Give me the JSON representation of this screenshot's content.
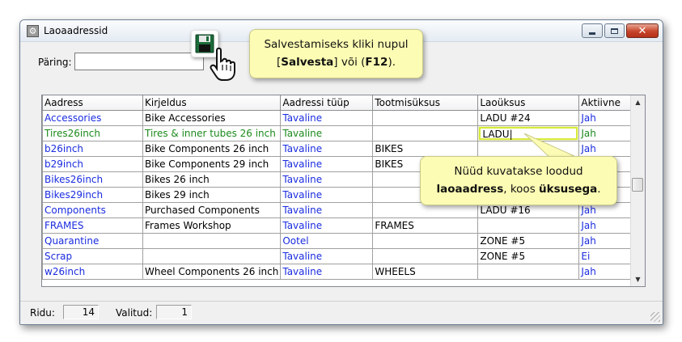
{
  "window": {
    "title": "Laoaadressid"
  },
  "query": {
    "label": "Päring:",
    "value": ""
  },
  "grid": {
    "columns": [
      "Aadress",
      "Kirjeldus",
      "Aadressi tüüp",
      "Tootmisüksus",
      "Laoüksus",
      "Aktiivne"
    ],
    "rows": [
      {
        "aadress": "Accessories",
        "kirjeldus": "Bike Accessories",
        "tyyp": "Tavaline",
        "tootmisyksus": "",
        "laoyksus": "LADU #24",
        "aktiivne": "Jah"
      },
      {
        "aadress": "Tires26inch",
        "kirjeldus": "Tires & inner tubes 26 inch",
        "tyyp": "Tavaline",
        "tootmisyksus": "",
        "laoyksus": "LADU",
        "aktiivne": "Jah"
      },
      {
        "aadress": "b26inch",
        "kirjeldus": "Bike Components 26 inch",
        "tyyp": "Tavaline",
        "tootmisyksus": "BIKES",
        "laoyksus": "",
        "aktiivne": "Jah"
      },
      {
        "aadress": "b29inch",
        "kirjeldus": "Bike Components 29 inch",
        "tyyp": "Tavaline",
        "tootmisyksus": "BIKES",
        "laoyksus": "",
        "aktiivne": ""
      },
      {
        "aadress": "Bikes26inch",
        "kirjeldus": "Bikes 26 inch",
        "tyyp": "Tavaline",
        "tootmisyksus": "",
        "laoyksus": "",
        "aktiivne": ""
      },
      {
        "aadress": "Bikes29inch",
        "kirjeldus": "Bikes 29 inch",
        "tyyp": "Tavaline",
        "tootmisyksus": "",
        "laoyksus": "",
        "aktiivne": ""
      },
      {
        "aadress": "Components",
        "kirjeldus": "Purchased Components",
        "tyyp": "Tavaline",
        "tootmisyksus": "",
        "laoyksus": "LADU #16",
        "aktiivne": "Jah"
      },
      {
        "aadress": "FRAMES",
        "kirjeldus": "Frames Workshop",
        "tyyp": "Tavaline",
        "tootmisyksus": "FRAMES",
        "laoyksus": "",
        "aktiivne": "Jah"
      },
      {
        "aadress": "Quarantine",
        "kirjeldus": "",
        "tyyp": "Ootel",
        "tootmisyksus": "",
        "laoyksus": "ZONE #5",
        "aktiivne": "Jah"
      },
      {
        "aadress": "Scrap",
        "kirjeldus": "",
        "tyyp": "Tavaline",
        "tootmisyksus": "",
        "laoyksus": "ZONE #5",
        "aktiivne": "Ei"
      },
      {
        "aadress": "w26inch",
        "kirjeldus": "Wheel Components 26 inch",
        "tyyp": "Tavaline",
        "tootmisyksus": "WHEELS",
        "laoyksus": "",
        "aktiivne": "Jah"
      }
    ]
  },
  "status": {
    "rows_label": "Ridu:",
    "rows_value": "14",
    "selected_label": "Valitud:",
    "selected_value": "1"
  },
  "callouts": {
    "save": {
      "line1": "Salvestamiseks kliki nupul",
      "bracket_open": "[",
      "bold1": "Salvesta",
      "mid": "] või (",
      "bold2": "F12",
      "end": ")."
    },
    "info": {
      "line1": "Nüüd kuvatakse loodud",
      "bold1": "laoaadress",
      "mid": ", koos ",
      "bold2": "üksusega",
      "end": "."
    }
  },
  "colors": {
    "link_blue": "#1a2ce0",
    "new_row_green": "#1b8a1b",
    "callout_bg": "#fcfcb4",
    "edit_highlight": "#d7ea3a"
  },
  "icons": {
    "app": "warehouse-app-icon",
    "save": "floppy-save-icon",
    "pointer": "hand-pointer-icon"
  }
}
